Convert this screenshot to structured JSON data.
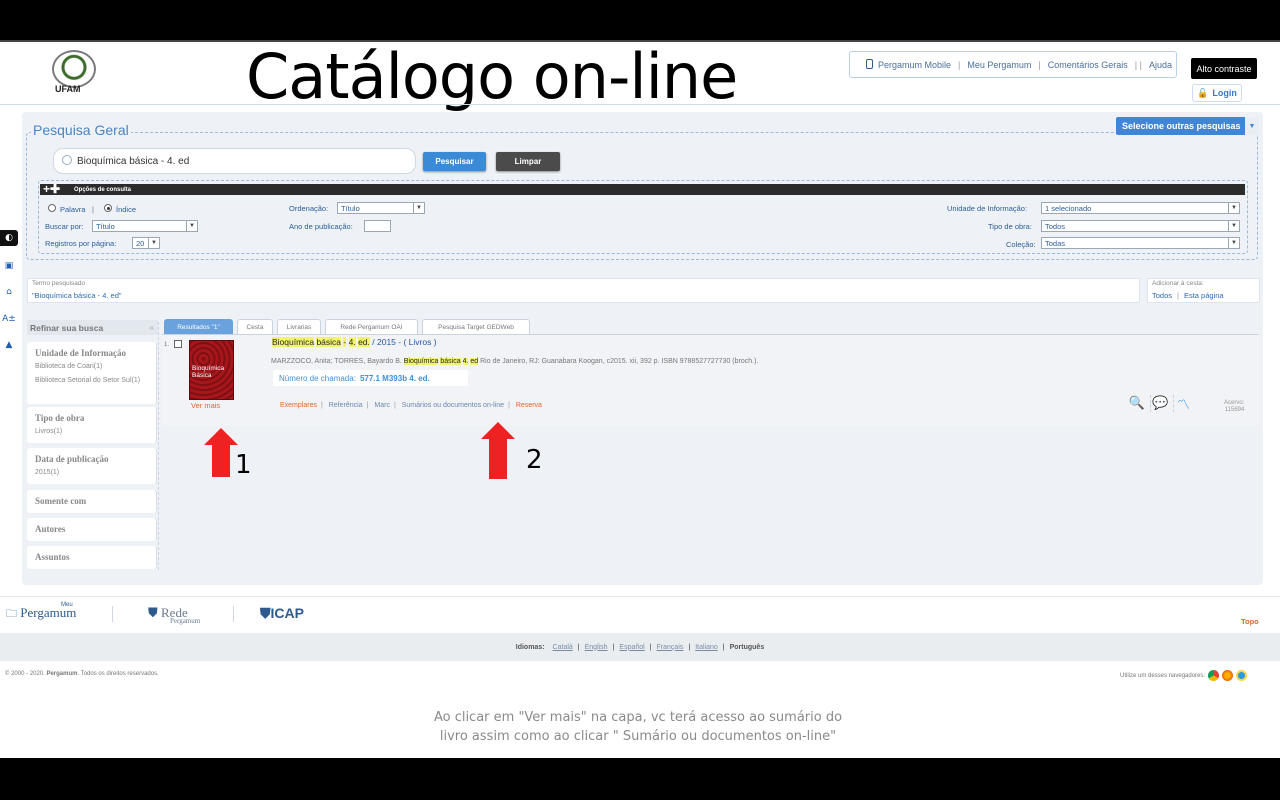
{
  "header": {
    "logo_text": "UFAM",
    "title": "Catálogo on-line",
    "top_links": [
      "Pergamum Mobile",
      "Meu Pergamum",
      "Comentários Gerais",
      "Ajuda"
    ],
    "top_link_extra_sep": "| |",
    "contrast_label": "Alto contraste",
    "login_label": "Login"
  },
  "search": {
    "section_title": "Pesquisa Geral",
    "other_searches_label": "Selecione outras pesquisas",
    "query": "Bioquímica básica - 4. ed",
    "search_button": "Pesquisar",
    "clear_button": "Limpar",
    "options_bar": "Opções de consulta",
    "radio_word": "Palavra",
    "radio_index": "Índice",
    "search_by_label": "Buscar por:",
    "search_by_value": "Título",
    "per_page_label": "Registros por página:",
    "per_page_value": "20",
    "order_label": "Ordenação:",
    "order_value": "Título",
    "year_label": "Ano de publicação:",
    "year_value": "",
    "unit_label": "Unidade de Informação:",
    "unit_value": "1 selecionado",
    "type_label": "Tipo de obra:",
    "type_value": "Todos",
    "collection_label": "Coleção:",
    "collection_value": "Todas"
  },
  "term": {
    "label": "Termo pesquisado",
    "value": "\"Bioquímica básica - 4. ed\"",
    "add_label": "Adicionar à cesta:",
    "add_all": "Todos",
    "add_page": "Esta página"
  },
  "refine": {
    "header": "Refinar sua busca",
    "groups": [
      {
        "title": "Unidade de Informação",
        "items": [
          "Biblioteca de Coari(1)",
          "Biblioteca Setorial do Setor Sul(1)"
        ]
      },
      {
        "title": "Tipo de obra",
        "items": [
          "Livros(1)"
        ]
      },
      {
        "title": "Data de publicação",
        "items": [
          "2015(1)"
        ]
      },
      {
        "title": "Somente com",
        "items": []
      },
      {
        "title": "Autores",
        "items": []
      },
      {
        "title": "Assuntos",
        "items": []
      }
    ]
  },
  "tabs": [
    "Resultados \"1\"",
    "Cesta",
    "Livrarias",
    "Rede Pergamum OAI",
    "Pesquisa Target GEDWeb"
  ],
  "result": {
    "number": "1.",
    "title_parts": [
      "Bioquímica",
      "básica",
      "-",
      "4.",
      "ed."
    ],
    "title_rest": "/ 2015 - ( Livros )",
    "authors_pre": "MARZZOCO, Anita; TORRES, Bayardo B.",
    "authors_hl": [
      "Bioquímica",
      "básica",
      "4.",
      "ed"
    ],
    "authors_post": "Rio de Janeiro, RJ: Guanabara Koogan, c2015. xii, 392 p. ISBN 9788527727730 (broch.).",
    "callno_label": "Número de chamada:",
    "callno_value": "577.1 M393b 4. ed.",
    "cover_text": "Bioquímica Básica",
    "see_more": "Ver mais",
    "links": [
      "Exemplares",
      "Referência",
      "Marc",
      "Sumários ou documentos on-line",
      "Reserva"
    ],
    "acervo_label": "Acervo:",
    "acervo_value": "115694"
  },
  "annotations": {
    "arrow1": "1",
    "arrow2": "2"
  },
  "footer": {
    "logo_meu_top": "Meu",
    "logo_meu": "Pergamum",
    "logo_rede": "Rede",
    "logo_rede_sub": "Pergamum",
    "logo_icap": "ICAP",
    "topo": "Topo",
    "idiomas_label": "Idiomas:",
    "languages": [
      "Català",
      "English",
      "Español",
      "Français",
      "Italiano"
    ],
    "current_language": "Português",
    "copyright_pre": "© 2000 - 2020.",
    "copyright_brand": "Pergamum",
    "copyright_post": ". Todos os direitos reservados.",
    "browsers_text": "Utilize um desses navegadores:"
  },
  "caption": {
    "line1": "Ao clicar em \"Ver mais\" na capa, vc terá acesso ao sumário do",
    "line2": "livro assim como ao clicar \" Sumário ou documentos on-line\""
  },
  "colors": {
    "accent": "#3f86d9",
    "orange": "#e0662a",
    "arrow": "#ee2222",
    "highlight": "#f1f36a"
  }
}
